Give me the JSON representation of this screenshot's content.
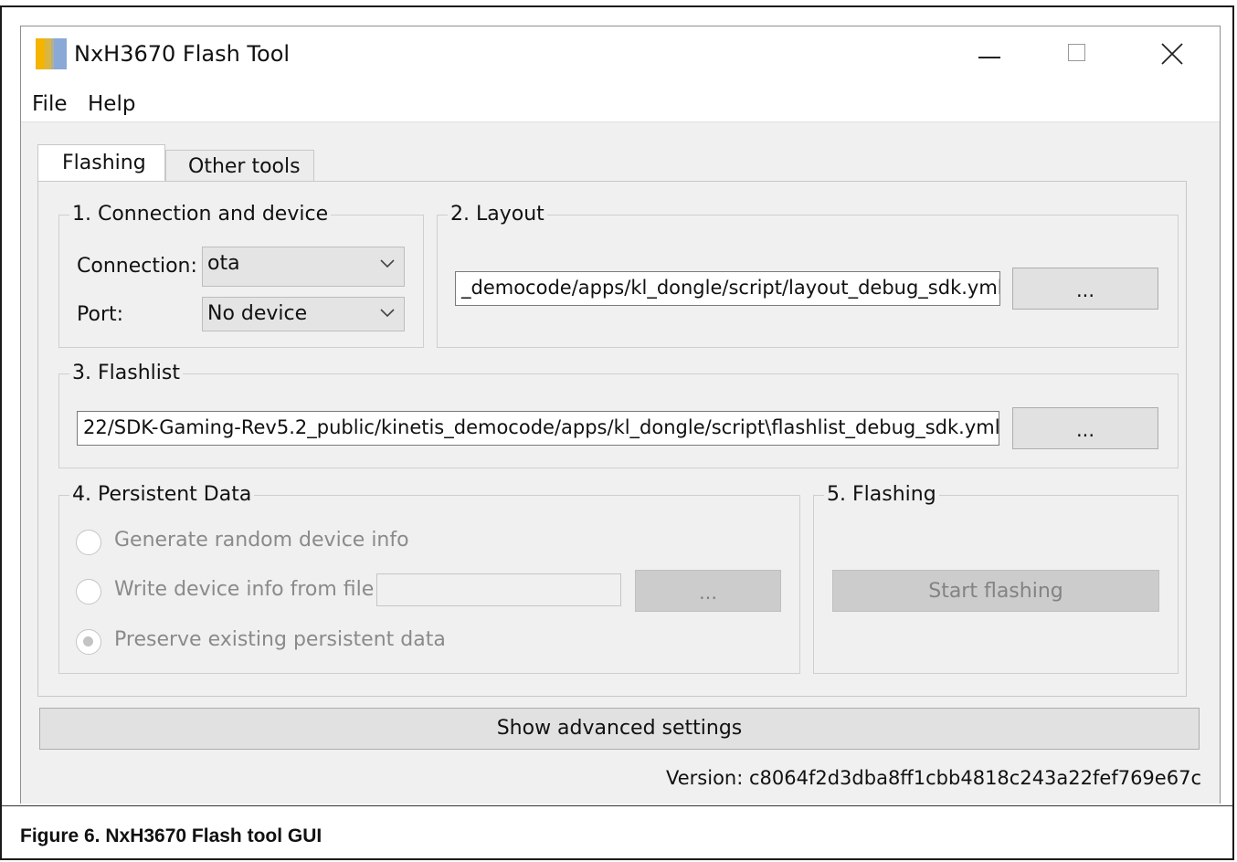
{
  "window": {
    "title": "NxH3670 Flash Tool",
    "colors": {
      "icon_left": "#f4b400",
      "icon_right": "#8aa9d6"
    }
  },
  "menu": {
    "file": "File",
    "help": "Help"
  },
  "tabs": [
    {
      "label": "Flashing",
      "active": true
    },
    {
      "label": "Other tools",
      "active": false
    }
  ],
  "connection_group": {
    "title": "1. Connection and device",
    "connection_label": "Connection:",
    "connection_value": "ota",
    "port_label": "Port:",
    "port_value": "No device"
  },
  "layout_group": {
    "title": "2. Layout",
    "path": "_democode/apps/kl_dongle/script/layout_debug_sdk.yml",
    "browse_label": "..."
  },
  "flashlist_group": {
    "title": "3. Flashlist",
    "path": "22/SDK-Gaming-Rev5.2_public/kinetis_democode/apps/kl_dongle/script\\flashlist_debug_sdk.yml",
    "browse_label": "..."
  },
  "persistent_group": {
    "title": "4. Persistent Data",
    "options": [
      {
        "label": "Generate random device info",
        "checked": false
      },
      {
        "label": "Write device info from file",
        "checked": false
      },
      {
        "label": "Preserve existing persistent data",
        "checked": true
      }
    ],
    "file_value": "",
    "browse_label": "..."
  },
  "flashing_group": {
    "title": "5. Flashing",
    "start_label": "Start flashing"
  },
  "advanced_label": "Show advanced settings",
  "version": "Version: c8064f2d3dba8ff1cbb4818c243a22fef769e67c",
  "caption": "Figure 6.  NxH3670 Flash tool GUI"
}
